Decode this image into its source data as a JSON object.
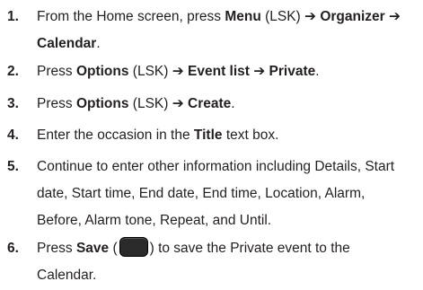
{
  "steps": [
    {
      "number": "1.",
      "lines": [
        {
          "t1": "From the Home screen, press ",
          "b1": "Menu",
          "t2": " (LSK) ",
          "b2": "➔ Organizer ➔"
        },
        {
          "b1": "Calendar",
          "t1": "."
        }
      ]
    },
    {
      "number": "2.",
      "t1": "Press ",
      "b1": "Options",
      "t2": " (LSK) ",
      "b2": "➔ Event list ➔ Private",
      "t3": "."
    },
    {
      "number": "3.",
      "t1": "Press ",
      "b1": "Options",
      "t2": " (LSK) ",
      "b2": "➔ Create",
      "t3": "."
    },
    {
      "number": "4.",
      "t1": "Enter the occasion in the ",
      "b1": "Title",
      "t2": " text box."
    },
    {
      "number": "5.",
      "lines": [
        "Continue to enter other information including Details, Start",
        "date, Start time, End date, End time, Location, Alarm,",
        "Before, Alarm tone, Repeat, and Until."
      ]
    },
    {
      "number": "6.",
      "line1": {
        "t1": "Press ",
        "b1": "Save",
        "t2": " (",
        "t3": ") to save the Private event to the"
      },
      "line2": "Calendar."
    }
  ],
  "icons": {
    "save_key": "save-softkey-icon"
  },
  "colors": {
    "text": "#231f20",
    "key": "#2a2a2a"
  }
}
